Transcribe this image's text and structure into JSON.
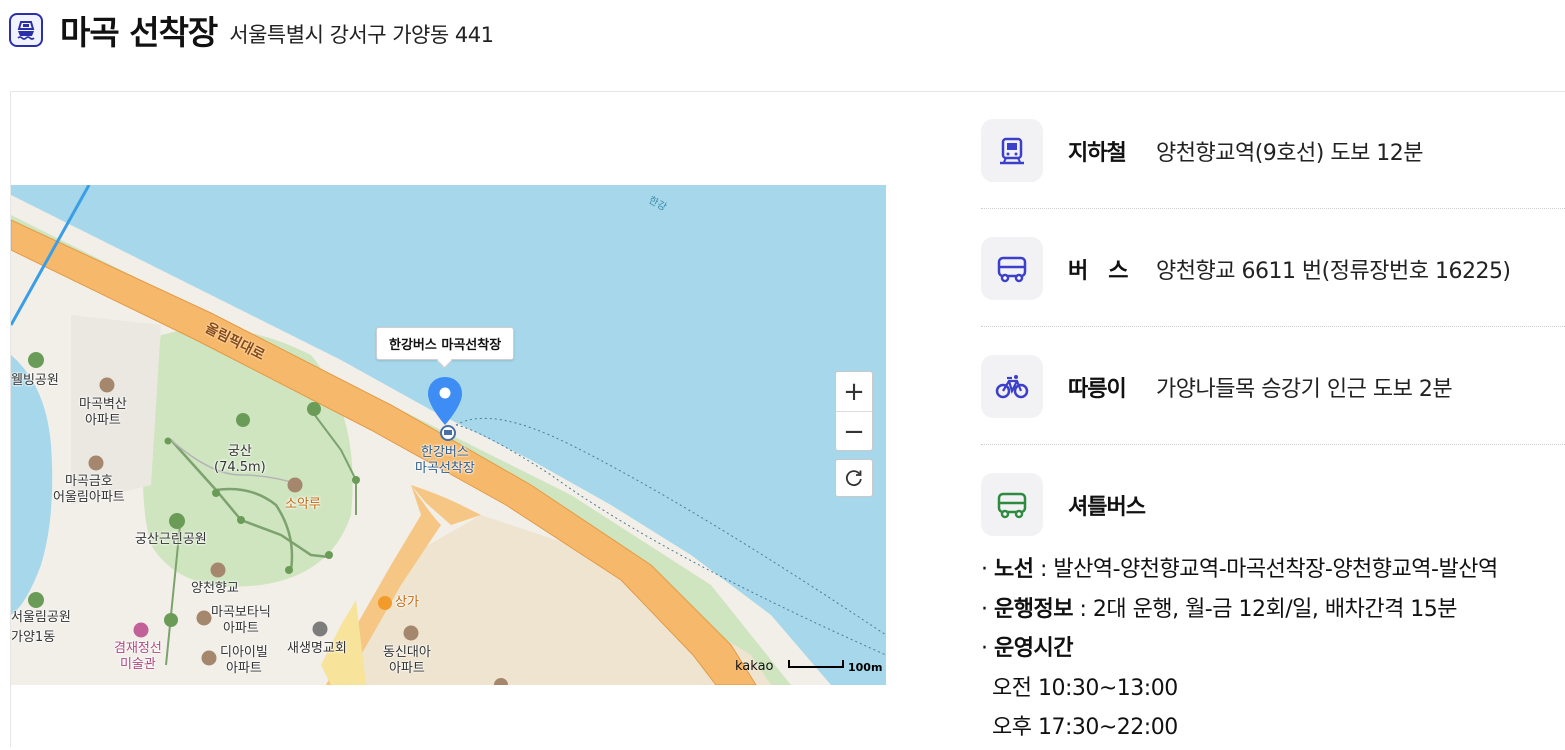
{
  "header": {
    "title": "마곡 선착장",
    "address": "서울특별시 강서구 가양동 441"
  },
  "map": {
    "tooltip": "한강버스 마곡선착장",
    "marker_label": [
      "한강버스",
      "마곡선착장"
    ],
    "road_label": "올림픽대로",
    "river_label": "한강",
    "labels": {
      "wellbeing_park": "웰빙공원",
      "magok_byeoksan": [
        "마곡벽산",
        "아파트"
      ],
      "magok_geumho": [
        "마곡금호",
        "어울림아파트"
      ],
      "gungsan": [
        "궁산",
        "(74.5m)"
      ],
      "soakru": "소악루",
      "gungsan_park": "궁산근린공원",
      "yangcheon_school": "양천향교",
      "magok_botanic": [
        "마곡보타닉",
        "아파트"
      ],
      "gyeomjae_museum": [
        "겸재정선",
        "미술관"
      ],
      "diaibel": [
        "디아이빌",
        "아파트"
      ],
      "saesaengmyeong": "새생명교회",
      "dongsin": [
        "동신대아",
        "아파트"
      ],
      "sangga": "상가",
      "eoulim_park": "서울림공원",
      "gayang1": "가양1동"
    },
    "zoom_in": "+",
    "zoom_out": "−",
    "attribution": "kakao",
    "scale": "100m"
  },
  "info": [
    {
      "icon": "subway-icon",
      "label": "지하철",
      "value": "양천향교역(9호선) 도보 12분",
      "color": "#3b3fc9"
    },
    {
      "icon": "bus-icon",
      "label": "버　스",
      "value": "양천향교 6611 번(정류장번호 16225)",
      "color": "#3b3fc9"
    },
    {
      "icon": "bicycle-icon",
      "label": "따릉이",
      "value": "가양나들목 승강기 인근 도보 2분",
      "color": "#3b3fc9"
    },
    {
      "icon": "shuttle-bus-icon",
      "label": "셔틀버스",
      "value": "",
      "color": "#2e8a3e"
    }
  ],
  "shuttle": {
    "route_label": "노선",
    "route_value": " : 발산역-양천향교역-마곡선착장-양천향교역-발산역",
    "ops_label": "운행정보",
    "ops_value": " : 2대 운행, 월-금 12회/일, 배차간격 15분",
    "hours_label": "운영시간",
    "hours_am": "오전 10:30~13:00",
    "hours_pm": "오후 17:30~22:00"
  }
}
